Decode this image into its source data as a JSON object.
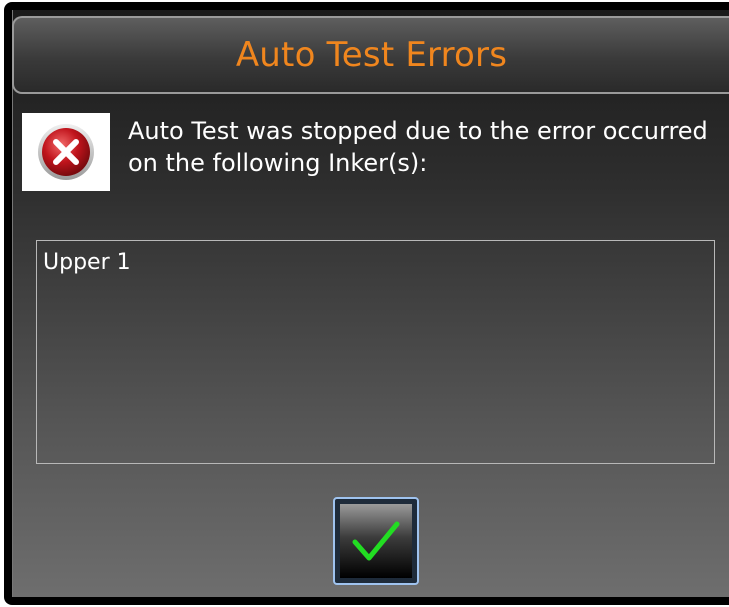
{
  "dialog": {
    "title": "Auto Test Errors",
    "message": "Auto Test was stopped due to the error occurred on the following Inker(s):",
    "inkers": [
      "Upper 1"
    ],
    "ok_icon": "checkmark-icon",
    "error_icon": "error-x-icon"
  },
  "colors": {
    "title": "#f0861e",
    "text": "#ffffff",
    "check": "#22dd22",
    "error_red": "#c0141c"
  }
}
